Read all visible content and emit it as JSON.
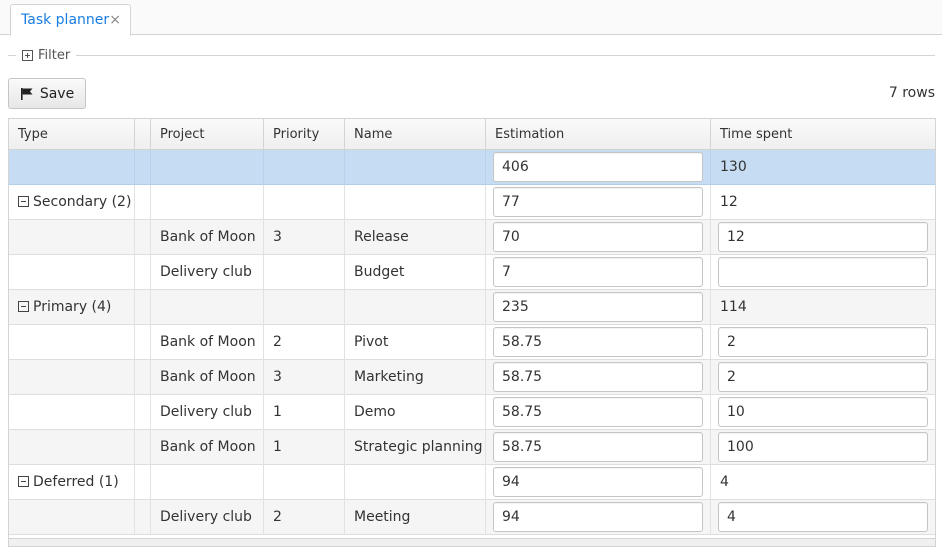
{
  "tab": {
    "label": "Task planner",
    "close_glyph": "×"
  },
  "filter": {
    "label": "Filter",
    "icon": "plus-square-icon"
  },
  "toolbar": {
    "save_label": "Save",
    "save_icon": "flag-icon",
    "rows_count": "7 rows"
  },
  "grid": {
    "columns": [
      "Type",
      "",
      "Project",
      "Priority",
      "Name",
      "Estimation",
      "Time spent"
    ],
    "rows": [
      {
        "kind": "total",
        "type": "",
        "project": "",
        "priority": "",
        "name": "",
        "estimation": "406",
        "time_spent": "130",
        "time_editable": false
      },
      {
        "kind": "group",
        "type": "Secondary (2)",
        "project": "",
        "priority": "",
        "name": "",
        "estimation": "77",
        "time_spent": "12",
        "time_editable": false
      },
      {
        "kind": "item",
        "type": "",
        "project": "Bank of Moon",
        "priority": "3",
        "name": "Release",
        "estimation": "70",
        "time_spent": "12",
        "time_editable": true
      },
      {
        "kind": "item",
        "type": "",
        "project": "Delivery club",
        "priority": "",
        "name": "Budget",
        "estimation": "7",
        "time_spent": "",
        "time_editable": true
      },
      {
        "kind": "group",
        "type": "Primary (4)",
        "project": "",
        "priority": "",
        "name": "",
        "estimation": "235",
        "time_spent": "114",
        "time_editable": false
      },
      {
        "kind": "item",
        "type": "",
        "project": "Bank of Moon",
        "priority": "2",
        "name": "Pivot",
        "estimation": "58.75",
        "time_spent": "2",
        "time_editable": true
      },
      {
        "kind": "item",
        "type": "",
        "project": "Bank of Moon",
        "priority": "3",
        "name": "Marketing",
        "estimation": "58.75",
        "time_spent": "2",
        "time_editable": true
      },
      {
        "kind": "item",
        "type": "",
        "project": "Delivery club",
        "priority": "1",
        "name": "Demo",
        "estimation": "58.75",
        "time_spent": "10",
        "time_editable": true
      },
      {
        "kind": "item",
        "type": "",
        "project": "Bank of Moon",
        "priority": "1",
        "name": "Strategic planning",
        "estimation": "58.75",
        "time_spent": "100",
        "time_editable": true
      },
      {
        "kind": "group",
        "type": "Deferred (1)",
        "project": "",
        "priority": "",
        "name": "",
        "estimation": "94",
        "time_spent": "4",
        "time_editable": false
      },
      {
        "kind": "item",
        "type": "",
        "project": "Delivery club",
        "priority": "2",
        "name": "Meeting",
        "estimation": "94",
        "time_spent": "4",
        "time_editable": true
      }
    ]
  },
  "colors": {
    "accent": "#197de1",
    "selected_row": "#c6dcf2"
  }
}
